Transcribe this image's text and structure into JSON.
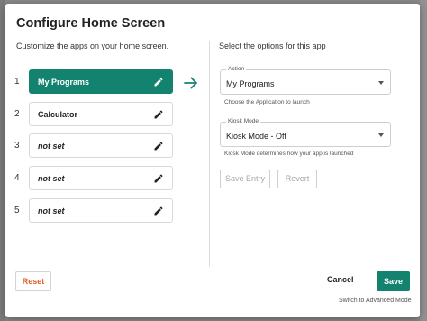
{
  "dialog": {
    "title": "Configure Home Screen",
    "left_description": "Customize the apps on your home screen.",
    "right_description": "Select the options for this app"
  },
  "slots": [
    {
      "number": "1",
      "label": "My Programs",
      "selected": true,
      "italic": false
    },
    {
      "number": "2",
      "label": "Calculator",
      "selected": false,
      "italic": false
    },
    {
      "number": "3",
      "label": "not set",
      "selected": false,
      "italic": true
    },
    {
      "number": "4",
      "label": "not set",
      "selected": false,
      "italic": true
    },
    {
      "number": "5",
      "label": "not set",
      "selected": false,
      "italic": true
    }
  ],
  "action_select": {
    "caption": "Action",
    "value": "My Programs",
    "helper": "Choose the Application to launch"
  },
  "kiosk_select": {
    "caption": "Kiosk Mode",
    "value": "Kiosk Mode - Off",
    "helper": "Kiosk Mode determines how your app is launched"
  },
  "buttons": {
    "save_entry": "Save Entry",
    "revert": "Revert",
    "reset": "Reset",
    "cancel": "Cancel",
    "save": "Save",
    "switch_mode": "Switch to Advanced Mode"
  },
  "icons": {
    "edit": "edit-pencil-icon",
    "arrow": "arrow-right-icon",
    "caret": "caret-down-icon"
  },
  "colors": {
    "accent": "#13836f",
    "reset_text": "#e0612c",
    "backdrop": "#8a8a8a"
  }
}
